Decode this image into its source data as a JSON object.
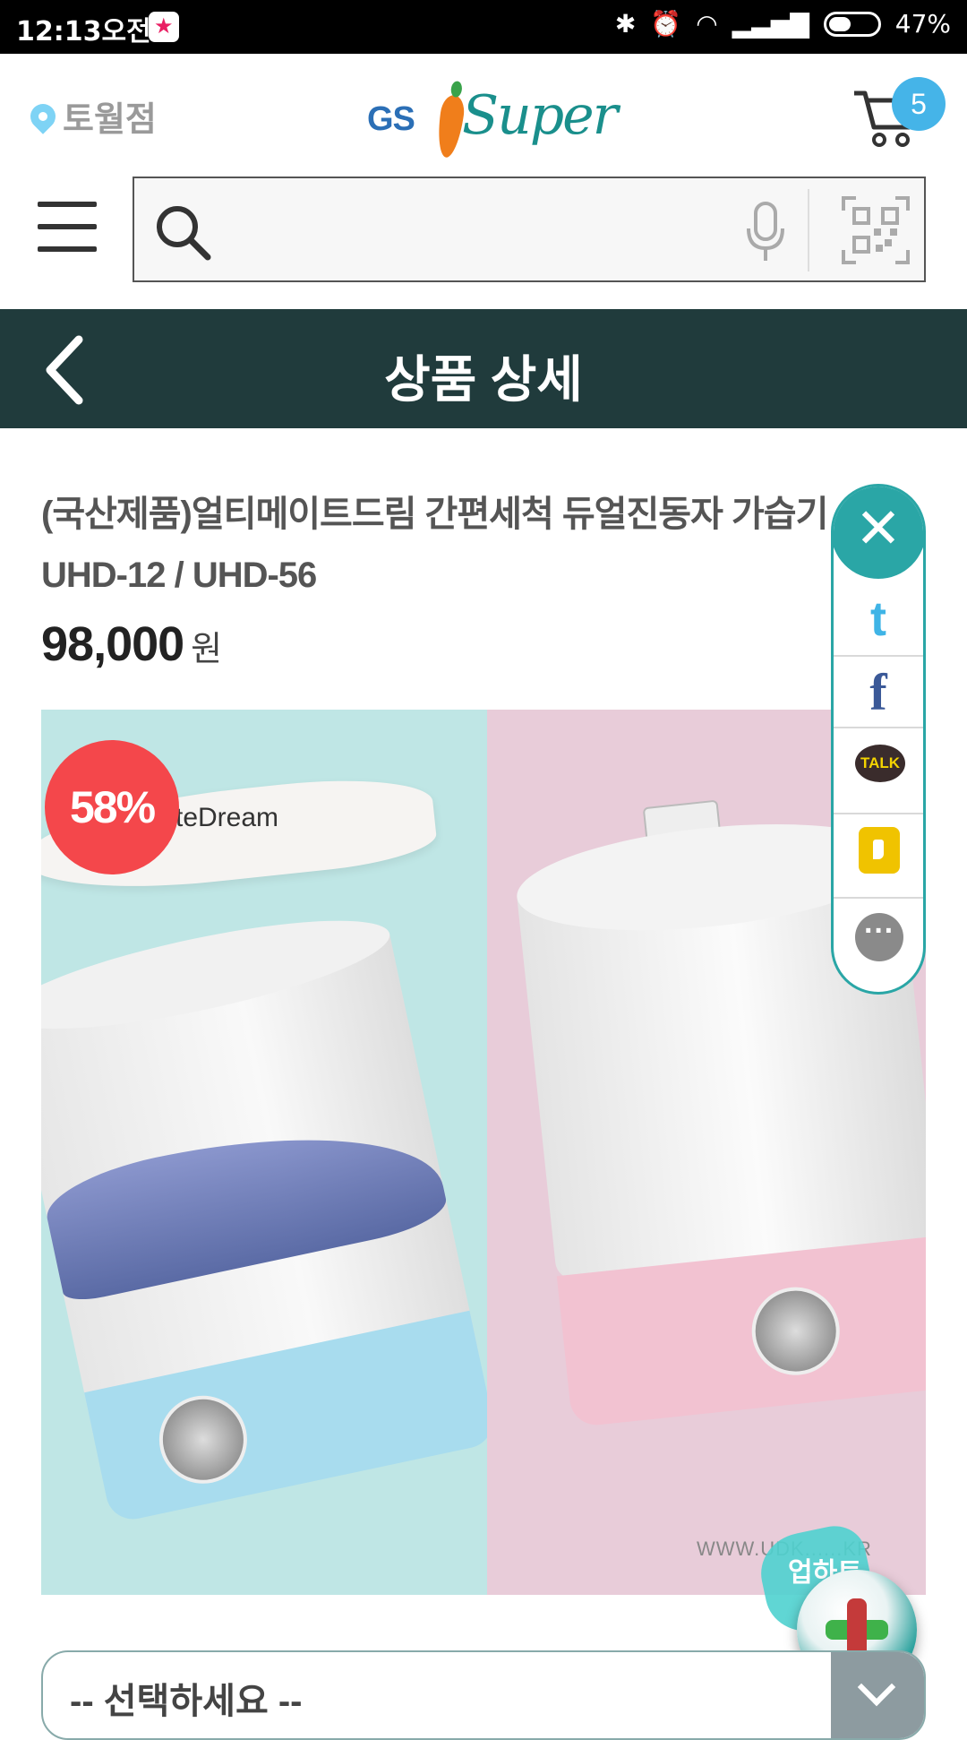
{
  "status_bar": {
    "time": "12:13오전",
    "battery": "47%",
    "battery_level": 0.47
  },
  "header": {
    "store": "토월점",
    "logo_gs": "GS",
    "logo_super": "Super",
    "cart_count": "5"
  },
  "search": {
    "placeholder": "",
    "value": ""
  },
  "title_bar": {
    "title": "상품 상세"
  },
  "product": {
    "name": "(국산제품)얼티메이트드림 간편세척 듀얼진동자 가습기 UHD-12 / UHD-56",
    "price": "98,000",
    "currency": "원",
    "discount": "58%",
    "image_brand": "teDream",
    "image_url_text": "WWW.UDK......KR"
  },
  "share": {
    "twitter": "t",
    "facebook": "f",
    "kakao_talk": "TALK",
    "more": "···"
  },
  "fab": {
    "bg_text": "업하트"
  },
  "option_select": {
    "selected": "-- 선택하세요 --"
  },
  "colors": {
    "title_bar_bg": "#203b3c",
    "accent": "#2aa6a6",
    "discount_badge": "#f4474b",
    "cart_badge": "#45b4e8"
  }
}
